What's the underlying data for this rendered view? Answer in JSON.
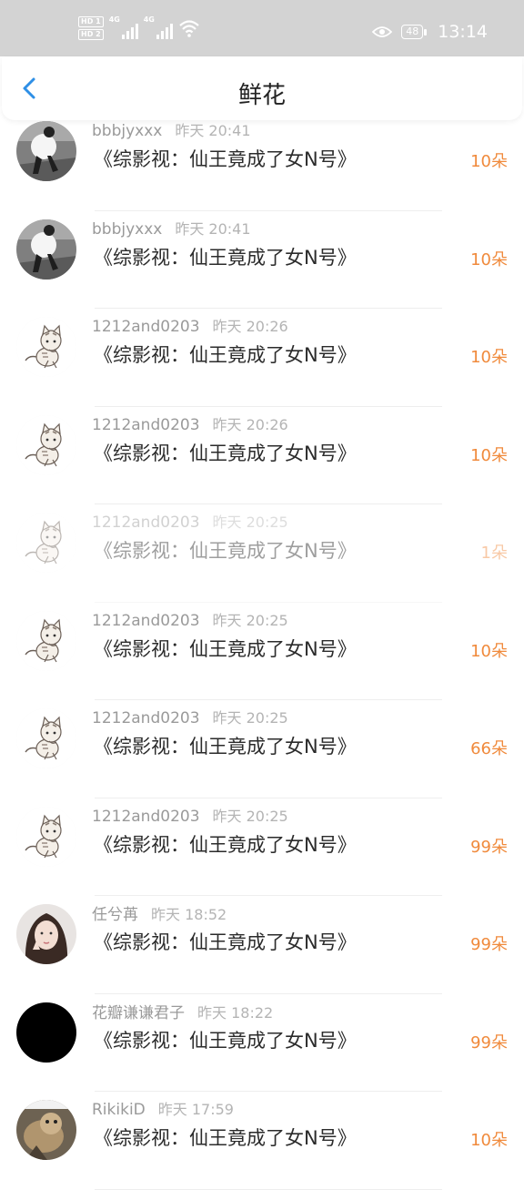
{
  "status_bar": {
    "hd1": "HD 1",
    "hd2": "HD 2",
    "net1": "4G",
    "net2": "4G",
    "battery": "48",
    "time": "13:14"
  },
  "header": {
    "title": "鲜花"
  },
  "rows": [
    {
      "user": "bbbjyxxx",
      "time": "昨天 20:41",
      "book": "《综影视：仙王竟成了女N号》",
      "count": "10朵",
      "avatar": "photo"
    },
    {
      "user": "bbbjyxxx",
      "time": "昨天 20:41",
      "book": "《综影视：仙王竟成了女N号》",
      "count": "10朵",
      "avatar": "photo"
    },
    {
      "user": "1212and0203",
      "time": "昨天 20:26",
      "book": "《综影视：仙王竟成了女N号》",
      "count": "10朵",
      "avatar": "cat"
    },
    {
      "user": "1212and0203",
      "time": "昨天 20:26",
      "book": "《综影视：仙王竟成了女N号》",
      "count": "10朵",
      "avatar": "cat"
    },
    {
      "user": "1212and0203",
      "time": "昨天 20:25",
      "book": "《综影视：仙王竟成了女N号》",
      "count": "1朵",
      "avatar": "cat"
    },
    {
      "user": "1212and0203",
      "time": "昨天 20:25",
      "book": "《综影视：仙王竟成了女N号》",
      "count": "10朵",
      "avatar": "cat"
    },
    {
      "user": "1212and0203",
      "time": "昨天 20:25",
      "book": "《综影视：仙王竟成了女N号》",
      "count": "66朵",
      "avatar": "cat"
    },
    {
      "user": "1212and0203",
      "time": "昨天 20:25",
      "book": "《综影视：仙王竟成了女N号》",
      "count": "99朵",
      "avatar": "cat"
    },
    {
      "user": "任兮苒",
      "time": "昨天 18:52",
      "book": "《综影视：仙王竟成了女N号》",
      "count": "99朵",
      "avatar": "girl"
    },
    {
      "user": "花瓣谦谦君子",
      "time": "昨天 18:22",
      "book": "《综影视：仙王竟成了女N号》",
      "count": "99朵",
      "avatar": "black"
    },
    {
      "user": "RikikiD",
      "time": "昨天 17:59",
      "book": "《综影视：仙王竟成了女N号》",
      "count": "10朵",
      "avatar": "pet"
    }
  ],
  "colors": {
    "accent": "#2e8fe6",
    "count": "#f08a3c",
    "status_bar": "#d3d3d3"
  }
}
